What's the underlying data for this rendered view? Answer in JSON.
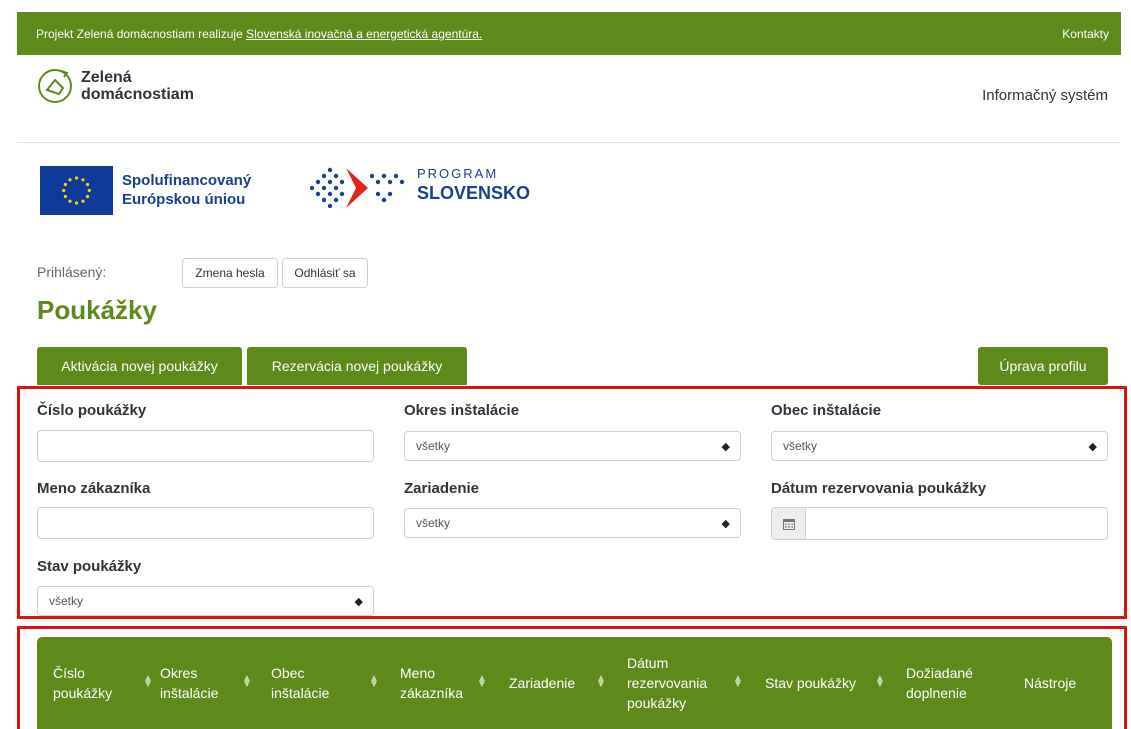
{
  "topbar": {
    "text": "Projekt Zelená domácnostiam realizuje ",
    "agency_link": "Slovenská inovačná a energetická agentúra.",
    "contacts": "Kontakty"
  },
  "header": {
    "logo_line1": "Zelená",
    "logo_line2": "domácnostiam",
    "info_system": "Informačný systém"
  },
  "sponsors": {
    "eu_line1": "Spolufinancovaný",
    "eu_line2": "Európskou úniou",
    "program_small": "PROGRAM",
    "program_big": "SLOVENSKO"
  },
  "account": {
    "logged_label": "Prihlásený:",
    "change_password": "Zmena hesla",
    "logout": "Odhlásiť sa"
  },
  "page": {
    "title": "Poukážky"
  },
  "tabs": {
    "activate": "Aktivácia novej poukážky",
    "reserve": "Rezervácia novej poukážky",
    "profile": "Úprava profilu"
  },
  "filters": {
    "voucher_number": {
      "label": "Číslo poukážky",
      "value": ""
    },
    "district": {
      "label": "Okres inštalácie",
      "selected": "všetky"
    },
    "municipality": {
      "label": "Obec inštalácie",
      "selected": "všetky"
    },
    "customer_name": {
      "label": "Meno zákazníka",
      "value": ""
    },
    "device": {
      "label": "Zariadenie",
      "selected": "všetky"
    },
    "reservation_date": {
      "label": "Dátum rezervovania poukážky",
      "value": ""
    },
    "status": {
      "label": "Stav poukážky",
      "selected": "všetky"
    }
  },
  "table": {
    "columns": [
      {
        "line1": "Číslo",
        "line2": "poukážky",
        "line3": ""
      },
      {
        "line1": "Okres",
        "line2": "inštalácie",
        "line3": ""
      },
      {
        "line1": "Obec",
        "line2": "inštalácie",
        "line3": ""
      },
      {
        "line1": "Meno",
        "line2": "zákazníka",
        "line3": ""
      },
      {
        "line1": "Zariadenie",
        "line2": "",
        "line3": ""
      },
      {
        "line1": "Dátum",
        "line2": "rezervovania",
        "line3": "poukážky"
      },
      {
        "line1": "Stav poukážky",
        "line2": "",
        "line3": ""
      },
      {
        "line1": "Dožiadané",
        "line2": "doplnenie",
        "line3": ""
      },
      {
        "line1": "Nástroje",
        "line2": "",
        "line3": ""
      }
    ]
  },
  "colors": {
    "brand_green": "#5e8a1c",
    "highlight_red": "#e0120e",
    "eu_blue": "#0f3a9a",
    "program_red": "#e2231a"
  }
}
